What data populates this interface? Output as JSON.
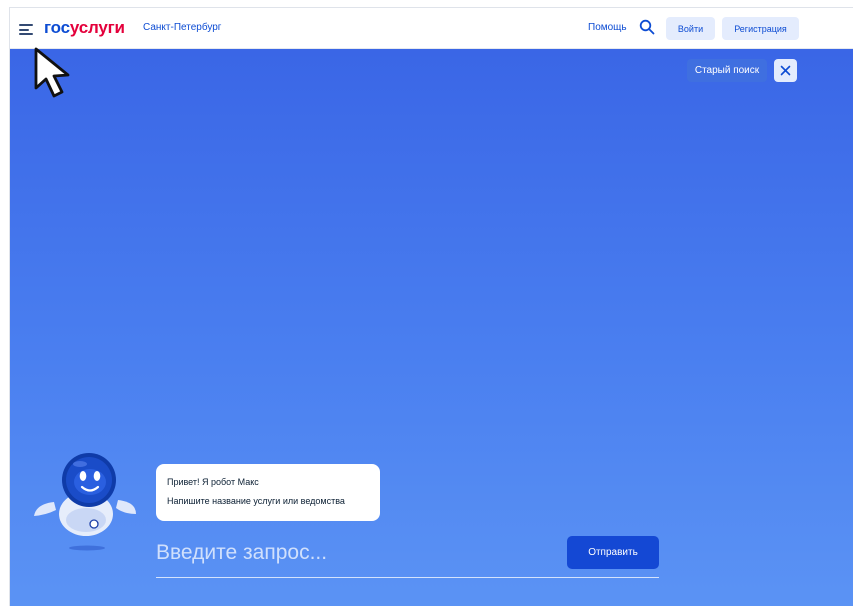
{
  "header": {
    "logo": {
      "part1": "гос",
      "part2": "услуги"
    },
    "city": "Санкт-Петербург",
    "help_label": "Помощь",
    "login_label": "Войти",
    "register_label": "Регистрация"
  },
  "main": {
    "old_search_label": "Старый поиск",
    "chat": {
      "greeting": "Привет! Я робот Макс",
      "hint": "Напишите название услуги или ведомства"
    },
    "query": {
      "placeholder": "Введите запрос...",
      "value": ""
    },
    "send_label": "Отправить"
  },
  "colors": {
    "brand_blue": "#0d4cd3",
    "brand_red": "#e4003b",
    "background_blue": "#4a7ff0",
    "button_light": "#e4ecfd",
    "send_button": "#1448d4"
  },
  "icons": [
    "menu-icon",
    "search-icon",
    "close-icon",
    "robot-max-avatar",
    "mouse-cursor"
  ]
}
